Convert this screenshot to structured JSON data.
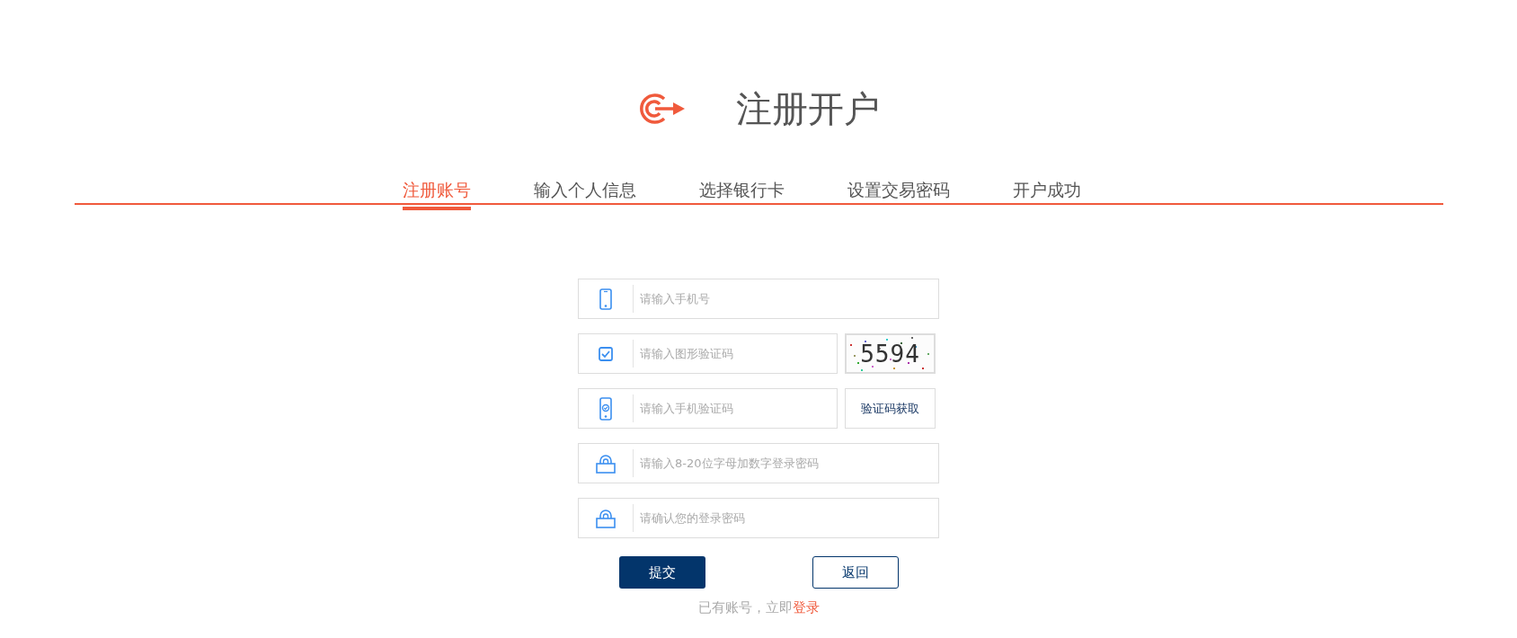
{
  "header": {
    "title": "注册开户"
  },
  "steps": [
    {
      "label": "注册账号",
      "selected": true
    },
    {
      "label": "输入个人信息",
      "selected": false
    },
    {
      "label": "选择银行卡",
      "selected": false
    },
    {
      "label": "设置交易密码",
      "selected": false
    },
    {
      "label": "开户成功",
      "selected": false
    }
  ],
  "form": {
    "fields": [
      {
        "kind": "phone",
        "placeholder": "请输入手机号"
      },
      {
        "kind": "captcha",
        "placeholder": "请输入图形验证码",
        "captcha_text": "5594"
      },
      {
        "kind": "sms",
        "placeholder": "请输入手机验证码",
        "button_label": "验证码获取"
      },
      {
        "kind": "password",
        "placeholder": "请输入8-20位字母加数字登录密码"
      },
      {
        "kind": "confirm",
        "placeholder": "请确认您的登录密码"
      }
    ],
    "buttons": [
      {
        "kind": "primary",
        "label": "提交"
      },
      {
        "kind": "outline",
        "label": "返回"
      }
    ],
    "footer": {
      "text": "已有账号，立即",
      "link": "登录"
    }
  }
}
